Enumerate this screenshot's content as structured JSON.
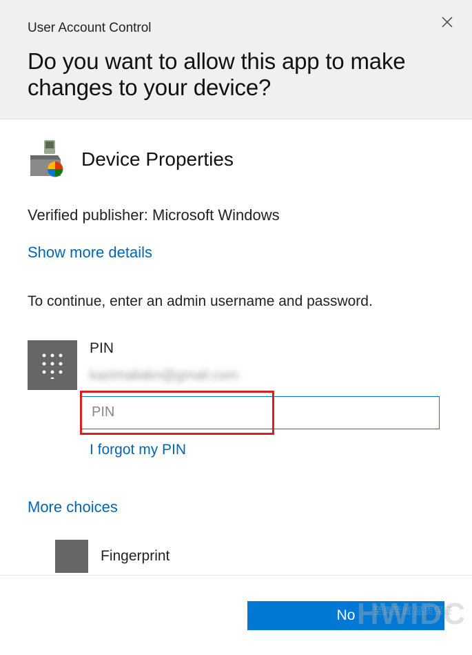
{
  "dialog": {
    "title": "User Account Control",
    "question": "Do you want to allow this app to make changes to your device?"
  },
  "app": {
    "name": "Device Properties",
    "publisher_prefix": "Verified publisher: ",
    "publisher": "Microsoft Windows"
  },
  "links": {
    "show_more": "Show more details",
    "forgot_pin": "I forgot my PIN",
    "more_choices": "More choices"
  },
  "instruction": "To continue, enter an admin username and password.",
  "credential": {
    "method_label": "PIN",
    "email_blurred": "kazimaliakn@gmail.com",
    "pin_placeholder": "PIN"
  },
  "alt_method": {
    "label": "Fingerprint"
  },
  "buttons": {
    "no": "No"
  },
  "watermark": {
    "main": "HWIDC",
    "sub": "至真至诚 品质保证"
  }
}
